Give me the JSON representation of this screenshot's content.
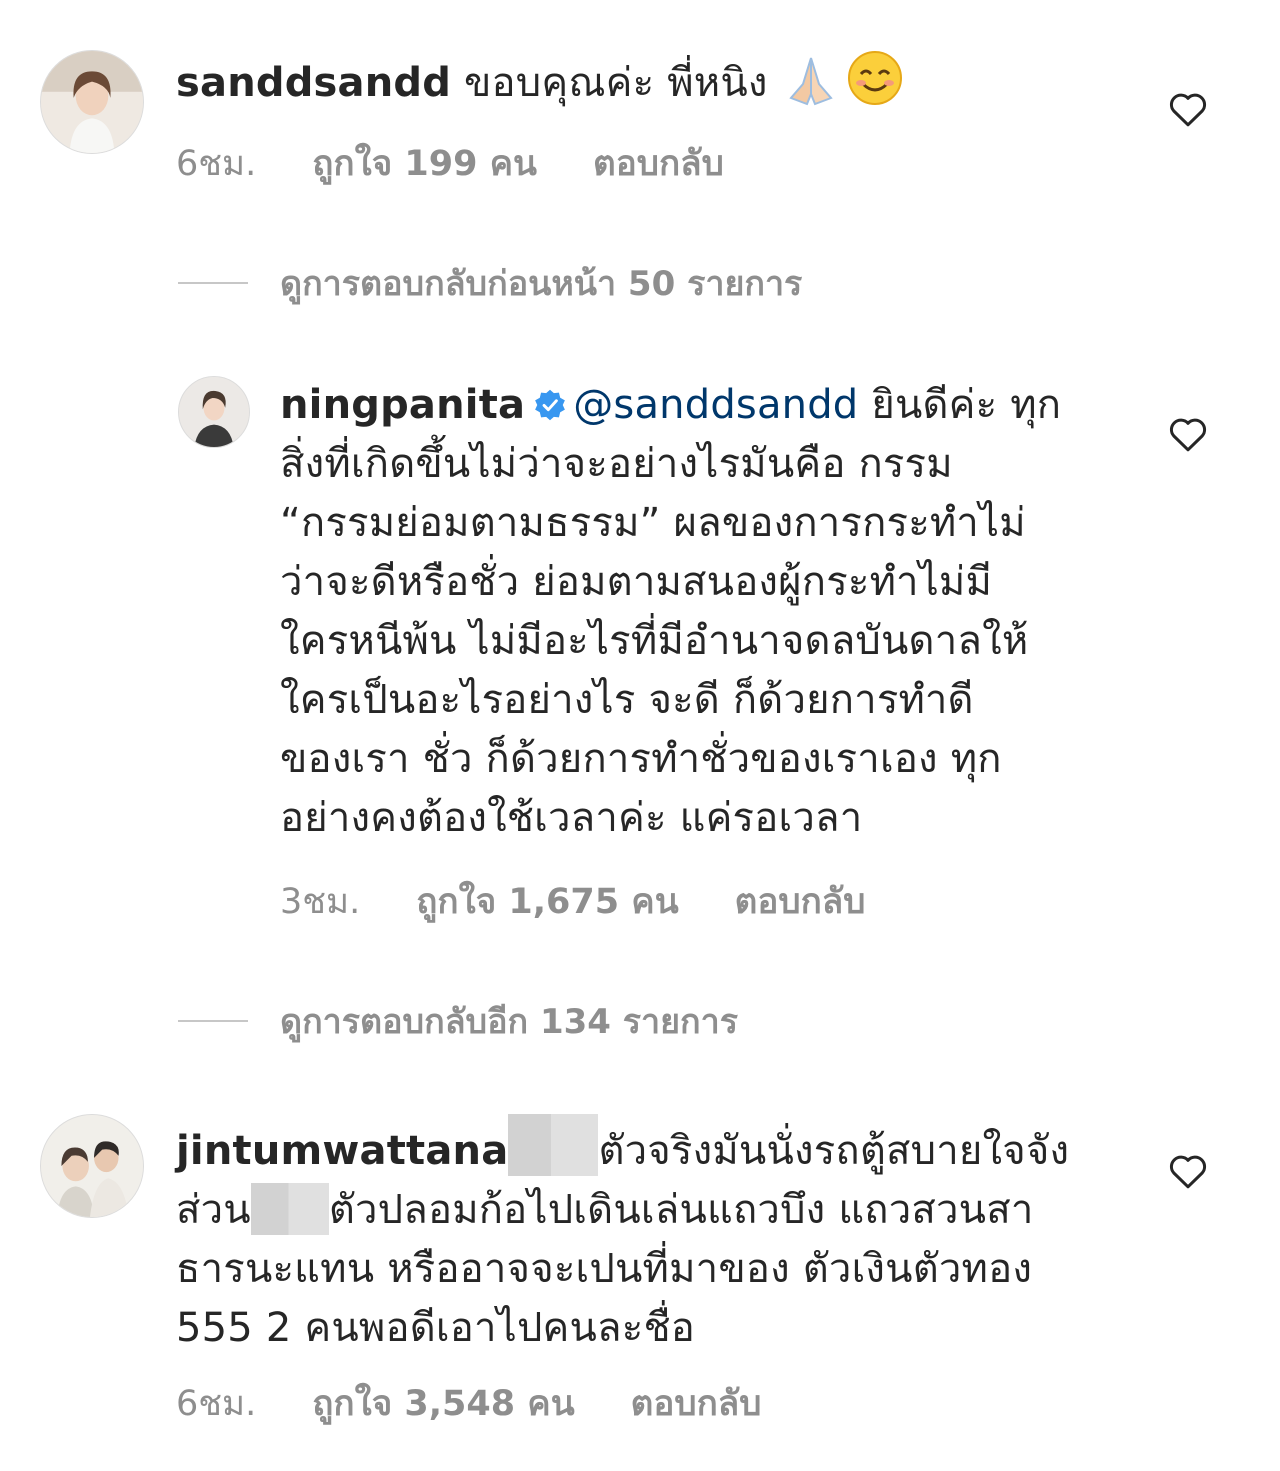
{
  "comments": [
    {
      "username": "sanddsandd",
      "body": " ขอบคุณค่ะ พี่หนิง ",
      "emojis": [
        "folded-hands-emoji",
        "smiling-face-emoji"
      ],
      "time": "6ชม.",
      "likes": "ถูกใจ 199 คน",
      "reply": "ตอบกลับ"
    },
    {
      "username": "ningpanita",
      "verified": true,
      "mention": "@sanddsandd",
      "lines": [
        " ยินดีค่ะ ทุก",
        "สิ่งที่เกิดขึ้นไม่ว่าจะอย่างไรมันคือ กรรม",
        "“กรรมย่อมตามธรรม” ผลของการกระทำไม่",
        "ว่าจะดีหรือชั่ว  ย่อมตามสนองผู้กระทำไม่มี",
        "ใครหนีพ้น ไม่มีอะไรที่มีอำนาจดลบันดาลให้",
        "ใครเป็นอะไรอย่างไร  จะดี ก็ด้วยการทำดี",
        "ของเรา ชั่ว ก็ด้วยการทำชั่วของเราเอง  ทุก",
        "อย่างคงต้องใช้เวลาค่ะ แค่รอเวลา"
      ],
      "time": "3ชม.",
      "likes": "ถูกใจ 1,675 คน",
      "reply": "ตอบกลับ"
    },
    {
      "username": "jintumwattana",
      "line1_after": "ตัวจริงมันนั่งรถตู้สบายใจจัง",
      "line2_before": "ส่วน",
      "line2_after": "ตัวปลอมก้อไปเดินเล่นแถวบึง แถวสวนสา",
      "line3": "ธารนะแทน หรืออาจจะเปนที่มาของ ตัวเงินตัวทอง",
      "line4": "555 2 คนพอดีเอาไปคนละชื่อ",
      "time": "6ชม.",
      "likes": "ถูกใจ 3,548 คน",
      "reply": "ตอบกลับ"
    }
  ],
  "view_replies": [
    "ดูการตอบกลับก่อนหน้า 50 รายการ",
    "ดูการตอบกลับอีก 134 รายการ"
  ],
  "colors": {
    "text": "#262626",
    "secondary": "#8e8e8e",
    "mention": "#00376b",
    "verified": "#3897f0"
  }
}
